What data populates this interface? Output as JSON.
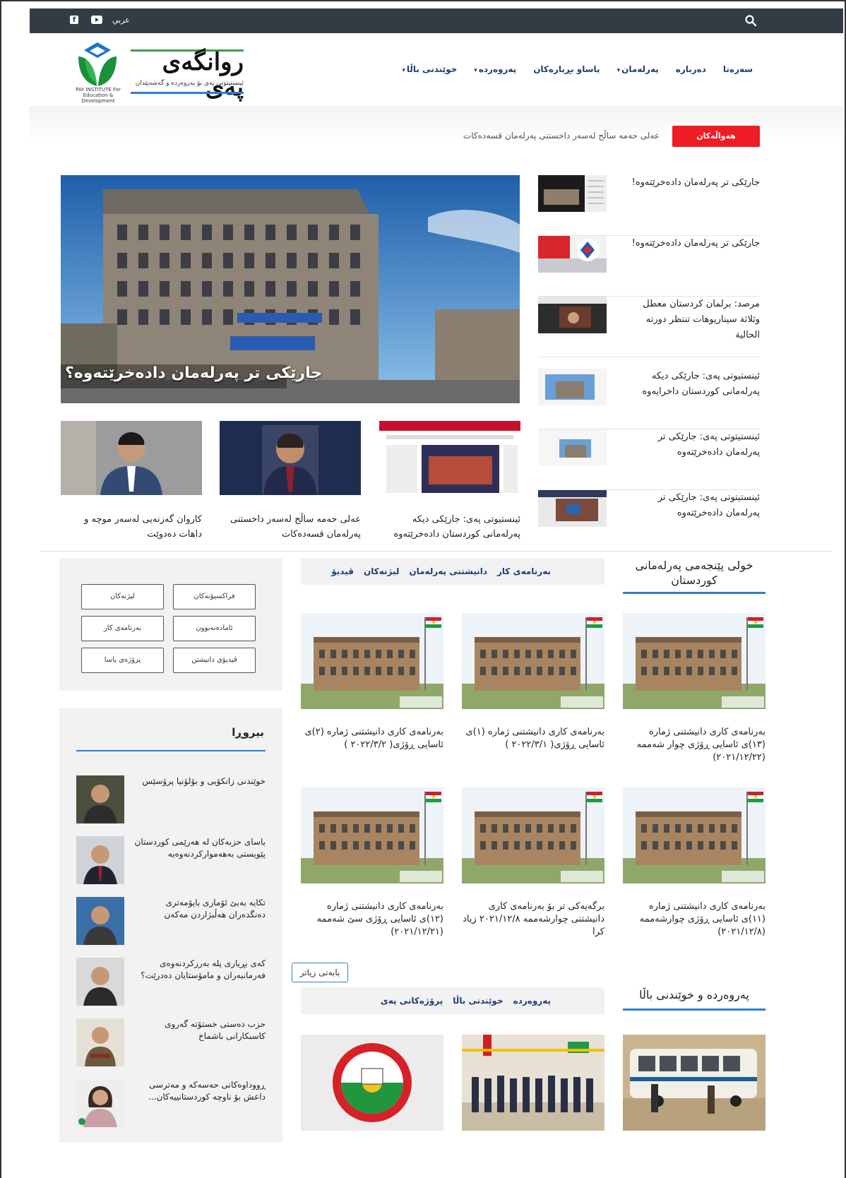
{
  "topbar": {
    "lang": "عربي"
  },
  "logo": {
    "title": "روانگەی پەی",
    "subtitle": "ئینستیتوتی پەی بۆ پەروەردە و گەشەپێدان",
    "small_text": "PAY INSTITUTE For Education & Development"
  },
  "nav": [
    {
      "label": "سەرەتا"
    },
    {
      "label": "دەربارە"
    },
    {
      "label": "پەرلەمان"
    },
    {
      "label": "یاساو بڕیارەکان"
    },
    {
      "label": "پەروەردە"
    },
    {
      "label": "خوێندنی باڵا"
    }
  ],
  "ticker": {
    "button": "هەواڵەکان",
    "text": "عەلی حەمە ساڵح لەسەر داخستنی پەرلەمان قسەدەکات"
  },
  "hero": {
    "caption": "جارێکی تر پەرلەمان دادەخرێتەوە؟"
  },
  "side_news": [
    {
      "title": "جارێکی تر پەرلەمان دادەخرێتەوە!"
    },
    {
      "title": "جارێکی تر پەرلەمان دادەخرێتەوە!"
    },
    {
      "title": "مرصد: برلمان كردستان معطل وثلاثة سيناريوهات تنتظر دورته الحالية"
    },
    {
      "title": "ئینستیوتی پەی: جارێکی دیکە پەرلەمانی کوردستان داخرایەوە"
    },
    {
      "title": "ئینستیتوتی پەی: جارێکی تر پەرلەمان دادەخرێتەوە"
    },
    {
      "title": "ئینستیتوتی پەی: جارێکی تر پەرلەمان دادەخرێتەوە"
    }
  ],
  "row_cards": [
    {
      "title": "ئینستیوتی پەی: جارێکی دیکە پەرلەمانی کوردستان دادەخرێتەوە"
    },
    {
      "title": "عەلی حەمە ساڵح لەسەر داخستنی پەرلەمان قسەدەکات"
    },
    {
      "title": "کاروان گەزنەیی لەسەر موچە و داهات دەدوێت"
    }
  ],
  "parliament_section": {
    "title": "خولی پێنجەمی پەرلەمانی کوردستان",
    "tabs": [
      "بەرنامەی کار",
      "دانیشتنی پەرلەمان",
      "لیژنەکان",
      "ڤیدیۆ"
    ],
    "cards": [
      {
        "title": "بەرنامەی کاری دانیشتنی ژمارە (١٣)ی ئاسایی ڕۆژی چوار شەممە (٢٠٢١/١٢/٢٢)"
      },
      {
        "title": "بەرنامەی کاری دانیشتنی ژمارە (١)ی ئاسایی ڕۆژی( ٢٠٢٢/٣/١ )"
      },
      {
        "title": "بەرنامەی کاری دانیشتنی ژمارە (٢)ی ئاسایی ڕۆژی( ٢٠٢٢/٣/٢ )"
      },
      {
        "title": "بەرنامەی کاری دانیشتنی ژمارە (١١)ی ئاسایی ڕۆژی چوارشەممە (٢٠٢١/١٢/٨)"
      },
      {
        "title": "برگەیەکی تر بۆ بەرنامەی کاری دانیشتنی چوارشەممە ٢٠٢١/١٢/٨ زیاد کرا"
      },
      {
        "title": "بەرنامەی کاری دانیشتنی ژمارە (١٢)ی ئاسایی ڕۆژی سێ شەممە (٢٠٢١/١٢/٢١)"
      }
    ],
    "more_button": "بابەتی زیاتر"
  },
  "education_section": {
    "title": "پەروەردە و خوێندنی باڵا",
    "tabs": [
      "پەروەردە",
      "خوێندنی باڵا",
      "پرۆژەکانی پەی"
    ]
  },
  "widget_buttons": [
    "فراکسیۆنەکان",
    "لیژنەکان",
    "ئامادەنەبوون",
    "بەرنامەی کار",
    "ڤیدیۆی دانیشتن",
    "پرۆژەی یاسا"
  ],
  "opinions": {
    "title": "بیروڕا",
    "items": [
      {
        "title": "خوێندنی زانکۆیی و بۆلۆنیا پرۆسێس"
      },
      {
        "title": "یاسای حزبەکان لە هەرێمی کوردستان پێویستی بەهەمواركردنەوەیە"
      },
      {
        "title": "تکایە بەبێ ئۆماری بایۆمەتری دەنگدەران هەڵبژاردن مەکەن"
      },
      {
        "title": "کەی بڕیاری پلە بەرزکردنەوەی فەرمانبەران و مامۆستایان دەدرێت؟"
      },
      {
        "title": "حزب دەستی خستۆتە گەروی کاسبکارانی باشماخ"
      },
      {
        "title": "ڕووداوەکانی حەسەکە و مەترسی داعش بۆ ناوچە کوردستانییەکان..."
      }
    ]
  },
  "colors": {
    "topbar": "#333b45",
    "accent_red": "#ee1c25",
    "accent_blue": "#2d7fd3",
    "nav": "#1e3f73"
  }
}
